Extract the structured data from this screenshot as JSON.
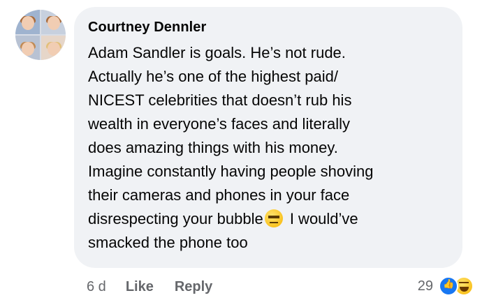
{
  "comment": {
    "author": "Courtney Dennler",
    "lines": [
      "Adam Sandler is goals. He’s not rude.",
      "Actually he’s one of the highest paid/",
      "NICEST celebrities that doesn’t rub his",
      "wealth in everyone’s faces and literally",
      "does amazing things with his money.",
      "Imagine constantly having people shoving",
      "their cameras and phones in your face"
    ],
    "line8_before": "disrespecting your bubble",
    "line8_after": " I would’ve",
    "line9": "smacked the phone too",
    "inline_emoji": "expressionless-face-emoji"
  },
  "actions": {
    "time": "6 d",
    "like_label": "Like",
    "reply_label": "Reply"
  },
  "reactions": {
    "count": "29",
    "icons": [
      "like-reaction-icon",
      "haha-reaction-icon"
    ],
    "like_color": "#1877f2"
  },
  "colors": {
    "bubble_bg": "#f0f2f5",
    "text": "#050505",
    "muted": "#65676b"
  }
}
